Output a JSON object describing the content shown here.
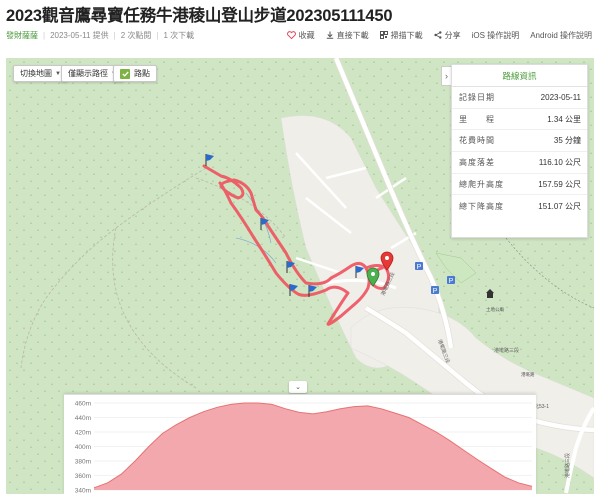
{
  "title": "2023觀音鷹尋寶任務牛港稜山登山步道202305111450",
  "meta": {
    "author": "發財薩薩",
    "provided": "2023-05-11 提供",
    "views": "2 次點閱",
    "downloads": "1 次下載"
  },
  "actions": [
    {
      "label": "收藏",
      "icon": "heart-icon"
    },
    {
      "label": "直接下載",
      "icon": "download-icon"
    },
    {
      "label": "掃描下載",
      "icon": "qr-scan-icon"
    },
    {
      "label": "分享",
      "icon": "share-icon"
    },
    {
      "label": "iOS 操作說明",
      "icon": "apple-icon"
    },
    {
      "label": "Android 操作說明",
      "icon": "android-icon"
    }
  ],
  "map_controls": {
    "switch_map": "切換地圖",
    "show_path": "僅顯示路徑",
    "trail_dots": "路點",
    "trail_dots_checked": true
  },
  "route_info": {
    "heading": "路線資訊",
    "rows": [
      {
        "label": "記錄日期",
        "value": "2023-05-11"
      },
      {
        "label": "里　　程",
        "value": "1.34 公里"
      },
      {
        "label": "花費時間",
        "value": "35 分鐘"
      },
      {
        "label": "高度落差",
        "value": "116.10 公尺"
      },
      {
        "label": "總爬升高度",
        "value": "157.59 公尺"
      },
      {
        "label": "總下降高度",
        "value": "151.07 公尺"
      }
    ]
  },
  "map_labels": {
    "road_1": "港墘路三段",
    "road_2": "港墘路三段",
    "road_3": "港墘路三段",
    "road_4": "港墘路三段",
    "place_1": "土地公廟",
    "place_2": "港墘路",
    "place_3": "北53-1"
  },
  "elevation": {
    "y_ticks": [
      "460m",
      "440m",
      "420m",
      "400m",
      "380m",
      "360m",
      "340m"
    ],
    "profile": [
      343,
      350,
      362,
      380,
      400,
      418,
      430,
      440,
      448,
      454,
      458,
      460,
      460,
      458,
      452,
      447,
      445,
      448,
      452,
      455,
      456,
      452,
      446,
      440,
      430,
      420,
      408,
      395,
      382,
      370,
      358,
      350,
      345
    ],
    "ymin": 340,
    "ymax": 460,
    "fill_color": "#f3a8ad",
    "line_color": "#e57373"
  },
  "colors": {
    "track": "#ef5561",
    "forest": "#cfe5c3",
    "brand_green": "#4a9a3a"
  }
}
